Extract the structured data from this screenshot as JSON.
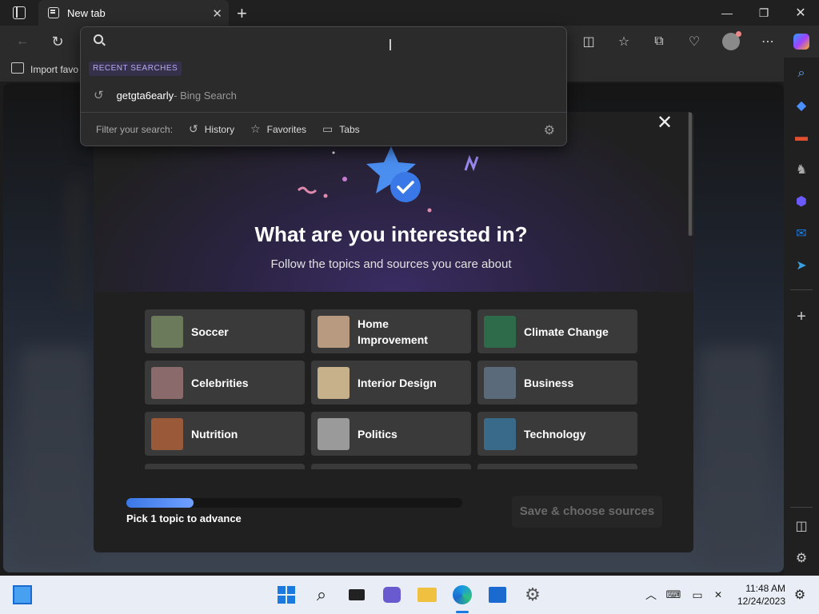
{
  "browser": {
    "tab_title": "New tab",
    "favorites_bar_item": "Import favo"
  },
  "address_dropdown": {
    "search_value": "",
    "recent_label": "RECENT SEARCHES",
    "recent_query": "getgta6early",
    "recent_source": " - Bing Search",
    "filter_label": "Filter your search:",
    "filters": [
      "History",
      "Favorites",
      "Tabs"
    ]
  },
  "modal": {
    "title": "What are you interested in?",
    "subtitle": "Follow the topics and sources you care about",
    "topics": [
      {
        "label": "Soccer",
        "color": "#6a7a5a"
      },
      {
        "label": "Home Improvement",
        "color": "#b89a80"
      },
      {
        "label": "Climate Change",
        "color": "#2d6b4a"
      },
      {
        "label": "Celebrities",
        "color": "#8a6a6a"
      },
      {
        "label": "Interior Design",
        "color": "#c7b18a"
      },
      {
        "label": "Business",
        "color": "#5a6a7a"
      },
      {
        "label": "Nutrition",
        "color": "#9a5a3a"
      },
      {
        "label": "Politics",
        "color": "#9a9a9a"
      },
      {
        "label": "Technology",
        "color": "#3a6a8a"
      }
    ],
    "progress_fraction": 0.2,
    "progress_label": "Pick 1 topic to advance",
    "save_button": "Save & choose sources"
  },
  "taskbar": {
    "time": "11:48 AM",
    "date": "12/24/2023"
  },
  "colors": {
    "accent": "#3b78e7",
    "recent_badge": "#b9a9f5"
  }
}
